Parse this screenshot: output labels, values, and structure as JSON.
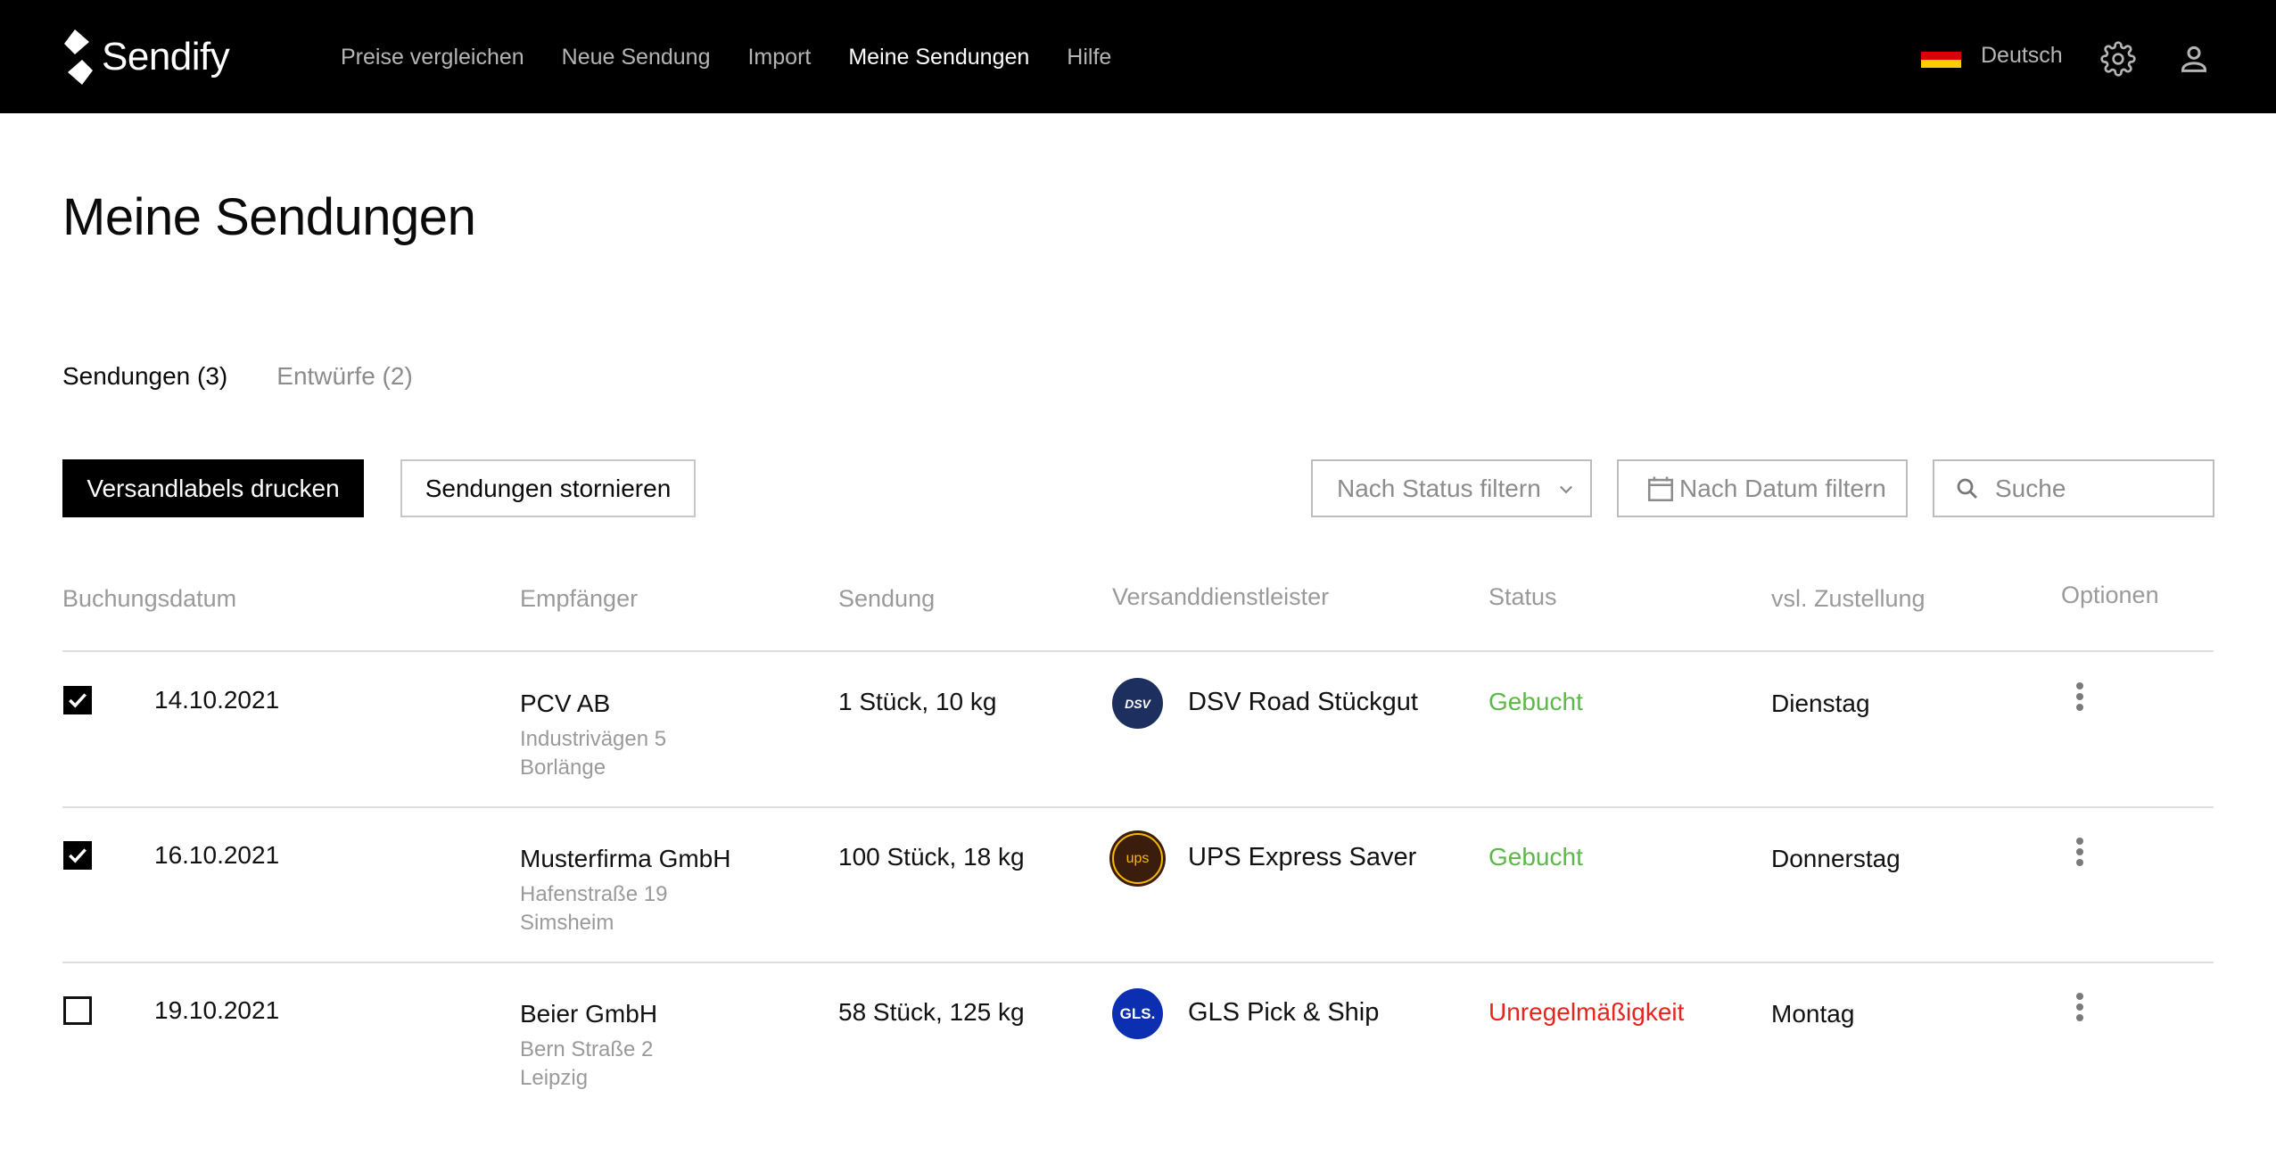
{
  "header": {
    "logo_text": "Sendify",
    "nav": [
      {
        "label": "Preise vergleichen",
        "active": false
      },
      {
        "label": "Neue Sendung",
        "active": false
      },
      {
        "label": "Import",
        "active": false
      },
      {
        "label": "Meine Sendungen",
        "active": true
      },
      {
        "label": "Hilfe",
        "active": false
      }
    ],
    "language": "Deutsch",
    "icons": [
      "flag-de-icon",
      "gear-icon",
      "user-icon"
    ]
  },
  "page": {
    "title": "Meine Sendungen",
    "tabs": [
      {
        "label": "Sendungen (3)",
        "active": true
      },
      {
        "label": "Entwürfe (2)",
        "active": false
      }
    ]
  },
  "toolbar": {
    "print_labels": "Versandlabels drucken",
    "cancel_shipments": "Sendungen stornieren",
    "status_filter": "Nach Status filtern",
    "date_filter": "Nach Datum filtern",
    "search_placeholder": "Suche"
  },
  "table": {
    "columns": [
      "Buchungsdatum",
      "Empfänger",
      "Sendung",
      "Versanddienstleister",
      "Status",
      "vsl. Zustellung",
      "Optionen"
    ],
    "rows": [
      {
        "checked": true,
        "date": "14.10.2021",
        "recipient": {
          "name": "PCV AB",
          "street": "Industrivägen 5",
          "city": "Borlänge"
        },
        "shipment": "1 Stück, 10 kg",
        "carrier": {
          "logo_text": "DSV",
          "name": "DSV Road Stückgut",
          "logo_color": "#1c2f5e"
        },
        "status": "Gebucht",
        "status_color": "#5cb84a",
        "delivery": "Dienstag"
      },
      {
        "checked": true,
        "date": "16.10.2021",
        "recipient": {
          "name": "Musterfirma GmbH",
          "street": "Hafenstraße 19",
          "city": "Simsheim"
        },
        "shipment": "100 Stück, 18 kg",
        "carrier": {
          "logo_text": "ups",
          "name": "UPS Express Saver",
          "logo_color": "#3b1d0e"
        },
        "status": "Gebucht",
        "status_color": "#5cb84a",
        "delivery": "Donnerstag"
      },
      {
        "checked": false,
        "date": "19.10.2021",
        "recipient": {
          "name": "Beier GmbH",
          "street": "Bern Straße 2",
          "city": "Leipzig"
        },
        "shipment": "58 Stück, 125 kg",
        "carrier": {
          "logo_text": "GLS.",
          "name": "GLS Pick & Ship",
          "logo_color": "#0b2fb0"
        },
        "status": "Unregelmäßigkeit",
        "status_color": "#e8241c",
        "delivery": "Montag"
      }
    ]
  },
  "colors": {
    "header_bg": "#000000",
    "primary_button": "#000000",
    "status_booked": "#5cb84a",
    "status_irregular": "#e8241c"
  }
}
